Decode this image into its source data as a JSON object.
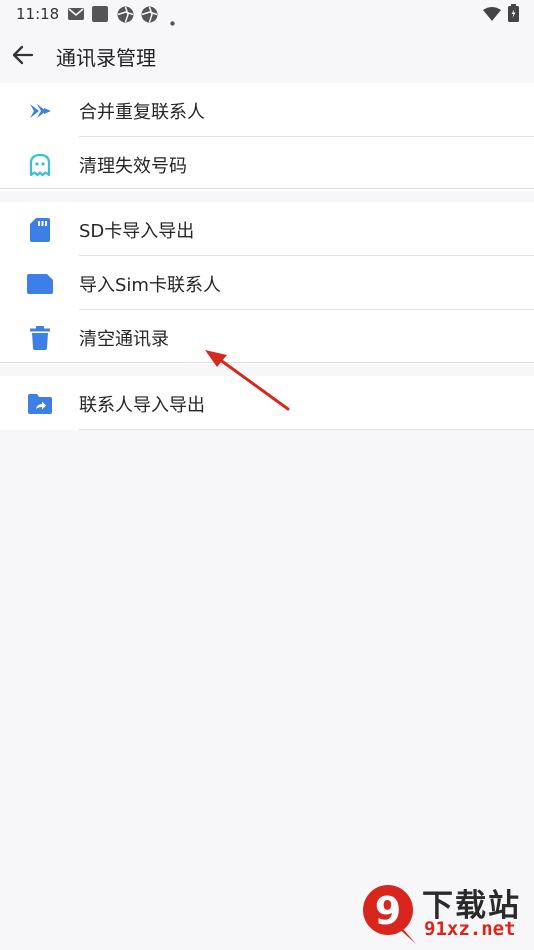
{
  "status_bar": {
    "time": "11:18",
    "icons": [
      "mail-icon",
      "app-square-icon",
      "aperture-icon",
      "aperture-icon",
      "dot-icon",
      "wifi-icon",
      "battery-icon"
    ]
  },
  "app_bar": {
    "title": "通讯录管理",
    "back_icon": "arrow-left-icon"
  },
  "groups": [
    {
      "items": [
        {
          "label": "合并重复联系人",
          "icon": "merge-arrow-icon"
        },
        {
          "label": "清理失效号码",
          "icon": "ghost-icon"
        }
      ]
    },
    {
      "items": [
        {
          "label": "SD卡导入导出",
          "icon": "sd-card-icon"
        },
        {
          "label": "导入Sim卡联系人",
          "icon": "sim-card-icon"
        },
        {
          "label": "清空通讯录",
          "icon": "trash-icon"
        }
      ]
    },
    {
      "items": [
        {
          "label": "联系人导入导出",
          "icon": "folder-share-icon"
        }
      ]
    }
  ],
  "watermark": {
    "text_cn": "下载站",
    "text_en": "91xz.net",
    "logo_text": "9"
  },
  "colors": {
    "accent_blue": "#3d7fe6",
    "annotation_red": "#d42b20",
    "background": "#f7f7f9",
    "card": "#ffffff"
  }
}
